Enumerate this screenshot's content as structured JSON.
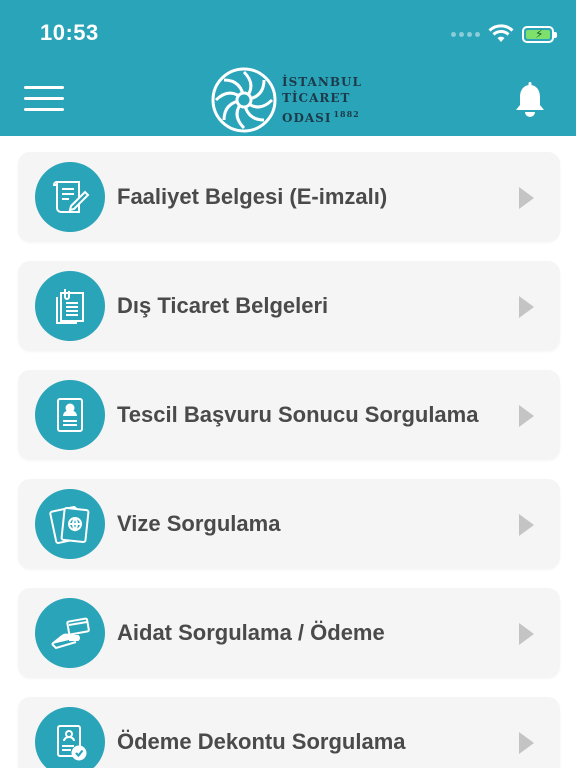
{
  "status_bar": {
    "time": "10:53"
  },
  "header": {
    "logo_line1": "İSTANBUL",
    "logo_line2": "TİCARET",
    "logo_line3": "ODASI",
    "logo_year": "1882",
    "menu_icon": "hamburger-icon",
    "bell_icon": "bell-icon"
  },
  "colors": {
    "primary": "#2aa4b8",
    "card_bg": "#f5f5f5",
    "text": "#4a4a4a",
    "chevron": "#c4c4c4"
  },
  "menu_items": [
    {
      "label": "Faaliyet Belgesi (E-imzalı)",
      "icon": "signed-document-icon"
    },
    {
      "label": "Dış Ticaret Belgeleri",
      "icon": "documents-icon"
    },
    {
      "label": "Tescil Başvuru Sonucu Sorgulama",
      "icon": "registration-form-icon"
    },
    {
      "label": "Vize Sorgulama",
      "icon": "passport-icon"
    },
    {
      "label": "Aidat Sorgulama / Ödeme",
      "icon": "card-payment-icon"
    },
    {
      "label": "Ödeme Dekontu Sorgulama",
      "icon": "receipt-check-icon"
    }
  ]
}
